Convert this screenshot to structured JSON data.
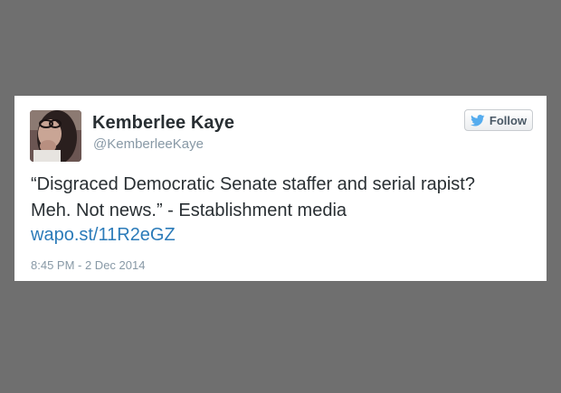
{
  "tweet": {
    "display_name": "Kemberlee Kaye",
    "screen_name": "@KemberleeKaye",
    "follow_label": "Follow",
    "follow_icon": "twitter-bird-icon",
    "text_lines": [
      "“Disgraced Democratic Senate staffer and serial rapist?",
      "Meh. Not news.” - Establishment media"
    ],
    "link": "wapo.st/11R2eGZ",
    "timestamp": "8:45 PM - 2 Dec 2014"
  },
  "colors": {
    "background": "#6f6f6f",
    "card": "#ffffff",
    "name": "#292f33",
    "muted": "#8899a6",
    "link": "#2b7bb9",
    "bird": "#55acee"
  }
}
